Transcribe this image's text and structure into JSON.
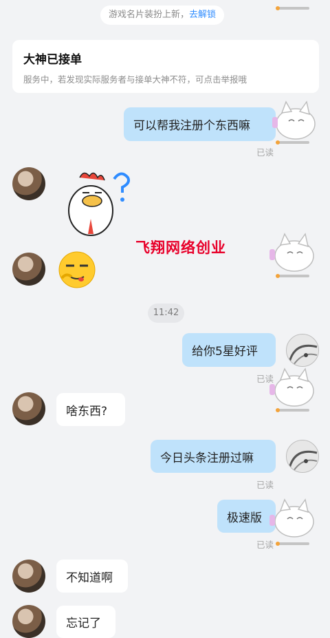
{
  "notice": {
    "text": "游戏名片装扮上新，",
    "link": "去解锁"
  },
  "service_card": {
    "title": "大神已接单",
    "description": "服务中，若发现实际服务者与接单大神不符，可点击举报哦"
  },
  "watermark": "飞翔网络创业",
  "messages": [
    {
      "side": "right",
      "text": "可以帮我注册个东西嘛",
      "status": "已读"
    },
    {
      "side": "left",
      "sticker": "rooster-question-sticker"
    },
    {
      "side": "left",
      "sticker": "smirk-emoji-sticker"
    },
    {
      "time": "11:42"
    },
    {
      "side": "right",
      "text": "给你5星好评",
      "status": "已读"
    },
    {
      "side": "left",
      "text": "啥东西?"
    },
    {
      "side": "right",
      "text": "今日头条注册过嘛",
      "status": "已读"
    },
    {
      "side": "right",
      "text": "极速版",
      "status": "已读"
    },
    {
      "side": "left",
      "text": "不知道啊"
    },
    {
      "side": "left",
      "text": "忘记了"
    }
  ],
  "colors": {
    "bubble_right": "#bfe2fb",
    "bubble_left": "#ffffff",
    "link": "#2f8cff",
    "watermark": "#e8002a"
  }
}
